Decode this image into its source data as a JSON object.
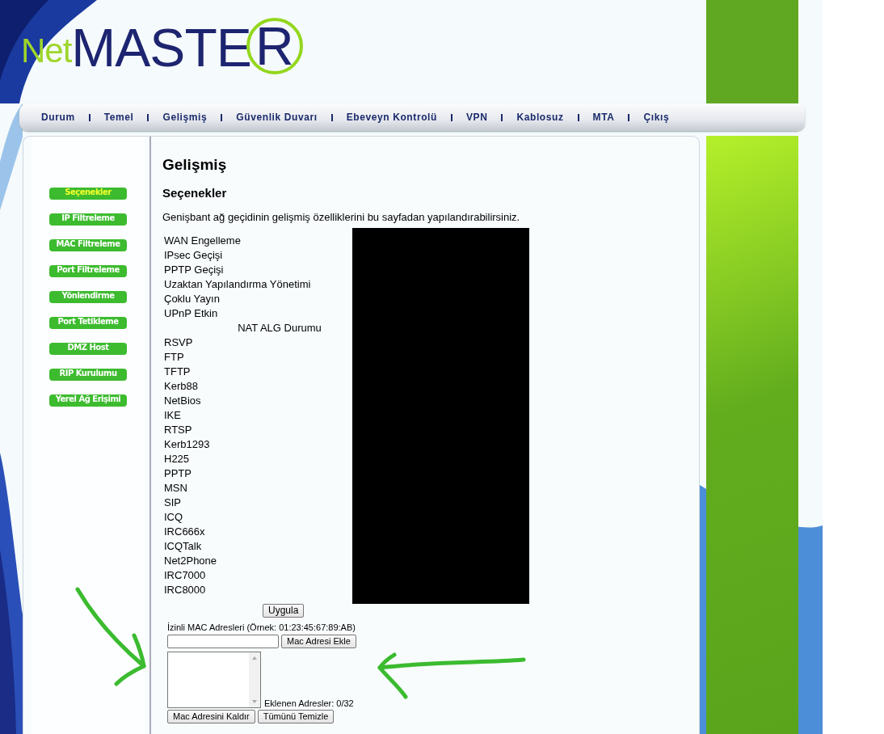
{
  "logo": {
    "light": "Net",
    "bold": "MASTE",
    "ringed": "R"
  },
  "nav": [
    {
      "label": "Durum"
    },
    {
      "label": "Temel"
    },
    {
      "label": "Gelişmiş"
    },
    {
      "label": "Güvenlik Duvarı"
    },
    {
      "label": "Ebeveyn Kontrolü"
    },
    {
      "label": "VPN"
    },
    {
      "label": "Kablosuz"
    },
    {
      "label": "MTA"
    },
    {
      "label": "Çıkış"
    }
  ],
  "sidebar": {
    "items": [
      {
        "label": "Seçenekler",
        "selected": true
      },
      {
        "label": "IP Filtreleme",
        "selected": false
      },
      {
        "label": "MAC Filtreleme",
        "selected": false
      },
      {
        "label": "Port Filtreleme",
        "selected": false
      },
      {
        "label": "Yönlendirme",
        "selected": false
      },
      {
        "label": "Port Tetikleme",
        "selected": false
      },
      {
        "label": "DMZ Host",
        "selected": false
      },
      {
        "label": "RIP Kurulumu",
        "selected": false
      },
      {
        "label": "Yerel Ağ Erişimi",
        "selected": false
      }
    ]
  },
  "content": {
    "title": "Gelişmiş",
    "subtitle": "Seçenekler",
    "description": "Genişbant ağ geçidinin gelişmiş özelliklerini bu sayfadan yapılandırabilirsiniz.",
    "options": [
      {
        "kind": "label",
        "text": "WAN Engelleme"
      },
      {
        "kind": "label",
        "text": "IPsec Geçişi"
      },
      {
        "kind": "label",
        "text": "PPTP Geçişi"
      },
      {
        "kind": "label",
        "text": "Uzaktan Yapılandırma Yönetimi"
      },
      {
        "kind": "label",
        "text": "Çoklu Yayın"
      },
      {
        "kind": "label",
        "text": "UPnP Etkin"
      },
      {
        "kind": "heading",
        "text": "NAT ALG Durumu"
      },
      {
        "kind": "label",
        "text": "RSVP"
      },
      {
        "kind": "label",
        "text": "FTP"
      },
      {
        "kind": "label",
        "text": "TFTP"
      },
      {
        "kind": "label",
        "text": "Kerb88"
      },
      {
        "kind": "label",
        "text": "NetBios"
      },
      {
        "kind": "label",
        "text": "IKE"
      },
      {
        "kind": "label",
        "text": "RTSP"
      },
      {
        "kind": "label",
        "text": "Kerb1293"
      },
      {
        "kind": "label",
        "text": "H225"
      },
      {
        "kind": "label",
        "text": "PPTP"
      },
      {
        "kind": "label",
        "text": "MSN"
      },
      {
        "kind": "label",
        "text": "SIP"
      },
      {
        "kind": "label",
        "text": "ICQ"
      },
      {
        "kind": "label",
        "text": "IRC666x"
      },
      {
        "kind": "label",
        "text": "ICQTalk"
      },
      {
        "kind": "label",
        "text": "Net2Phone"
      },
      {
        "kind": "label",
        "text": "IRC7000"
      },
      {
        "kind": "label",
        "text": "IRC8000"
      }
    ],
    "apply_button": "Uygula",
    "mac": {
      "label": "İzinli MAC Adresleri (Örnek: 01:23:45:67:89:AB)",
      "add_button": "Mac Adresi Ekle",
      "count": "Eklenen Adresler: 0/32",
      "remove_button": "Mac Adresini Kaldır",
      "clear_button": "Tümünü Temizle"
    }
  }
}
